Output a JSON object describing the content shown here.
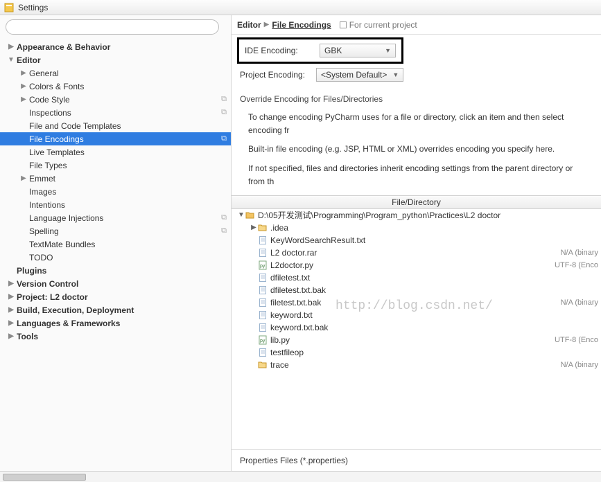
{
  "titlebar": {
    "title": "Settings"
  },
  "search": {
    "placeholder": ""
  },
  "sidebar": [
    {
      "label": "Appearance & Behavior",
      "level": 1,
      "arrow": "▶"
    },
    {
      "label": "Editor",
      "level": 1,
      "arrow": "▼"
    },
    {
      "label": "General",
      "level": 2,
      "arrow": "▶"
    },
    {
      "label": "Colors & Fonts",
      "level": 2,
      "arrow": "▶"
    },
    {
      "label": "Code Style",
      "level": 2,
      "arrow": "▶",
      "trail": "⧉"
    },
    {
      "label": "Inspections",
      "level": 2,
      "arrow": "",
      "trail": "⧉"
    },
    {
      "label": "File and Code Templates",
      "level": 2,
      "arrow": ""
    },
    {
      "label": "File Encodings",
      "level": 2,
      "arrow": "",
      "trail": "⧉",
      "selected": true
    },
    {
      "label": "Live Templates",
      "level": 2,
      "arrow": ""
    },
    {
      "label": "File Types",
      "level": 2,
      "arrow": ""
    },
    {
      "label": "Emmet",
      "level": 2,
      "arrow": "▶"
    },
    {
      "label": "Images",
      "level": 2,
      "arrow": ""
    },
    {
      "label": "Intentions",
      "level": 2,
      "arrow": ""
    },
    {
      "label": "Language Injections",
      "level": 2,
      "arrow": "",
      "trail": "⧉"
    },
    {
      "label": "Spelling",
      "level": 2,
      "arrow": "",
      "trail": "⧉"
    },
    {
      "label": "TextMate Bundles",
      "level": 2,
      "arrow": ""
    },
    {
      "label": "TODO",
      "level": 2,
      "arrow": ""
    },
    {
      "label": "Plugins",
      "level": 1,
      "arrow": ""
    },
    {
      "label": "Version Control",
      "level": 1,
      "arrow": "▶"
    },
    {
      "label": "Project: L2 doctor",
      "level": 1,
      "arrow": "▶"
    },
    {
      "label": "Build, Execution, Deployment",
      "level": 1,
      "arrow": "▶"
    },
    {
      "label": "Languages & Frameworks",
      "level": 1,
      "arrow": "▶"
    },
    {
      "label": "Tools",
      "level": 1,
      "arrow": "▶"
    }
  ],
  "breadcrumb": {
    "root": "Editor",
    "leaf": "File Encodings",
    "scope": "For current project"
  },
  "ide_encoding": {
    "label": "IDE Encoding:",
    "value": "GBK"
  },
  "project_encoding": {
    "label": "Project Encoding:",
    "value": "<System Default>"
  },
  "override_heading": "Override Encoding for Files/Directories",
  "desc1": "To change encoding PyCharm uses for a file or directory, click an item and then select encoding fr",
  "desc2": "Built-in file encoding (e.g. JSP, HTML or XML) overrides encoding you specify here.",
  "desc3": "If not specified, files and directories inherit encoding settings from the parent directory or from th",
  "tree_header": "File/Directory",
  "files": [
    {
      "indent": 0,
      "exp": "▼",
      "kind": "folder-open",
      "name": "D:\\05开发测试\\Programming\\Program_python\\Practices\\L2 doctor",
      "enc": ""
    },
    {
      "indent": 1,
      "exp": "▶",
      "kind": "folder",
      "name": ".idea",
      "enc": ""
    },
    {
      "indent": 1,
      "exp": "",
      "kind": "file",
      "name": "KeyWordSearchResult.txt",
      "enc": ""
    },
    {
      "indent": 1,
      "exp": "",
      "kind": "file",
      "name": "L2 doctor.rar",
      "enc": "N/A (binary"
    },
    {
      "indent": 1,
      "exp": "",
      "kind": "py",
      "name": "L2doctor.py",
      "enc": "UTF-8 (Enco"
    },
    {
      "indent": 1,
      "exp": "",
      "kind": "file",
      "name": "dfiletest.txt",
      "enc": ""
    },
    {
      "indent": 1,
      "exp": "",
      "kind": "file",
      "name": "dfiletest.txt.bak",
      "enc": ""
    },
    {
      "indent": 1,
      "exp": "",
      "kind": "file",
      "name": "filetest.txt.bak",
      "enc": "N/A (binary"
    },
    {
      "indent": 1,
      "exp": "",
      "kind": "file",
      "name": "keyword.txt",
      "enc": ""
    },
    {
      "indent": 1,
      "exp": "",
      "kind": "file",
      "name": "keyword.txt.bak",
      "enc": ""
    },
    {
      "indent": 1,
      "exp": "",
      "kind": "py",
      "name": "lib.py",
      "enc": "UTF-8 (Enco"
    },
    {
      "indent": 1,
      "exp": "",
      "kind": "file",
      "name": "testfileop",
      "enc": ""
    },
    {
      "indent": 1,
      "exp": "",
      "kind": "folder",
      "name": "trace",
      "enc": "N/A (binary"
    }
  ],
  "watermark": "http://blog.csdn.net/",
  "properties_label": "Properties Files (*.properties)"
}
